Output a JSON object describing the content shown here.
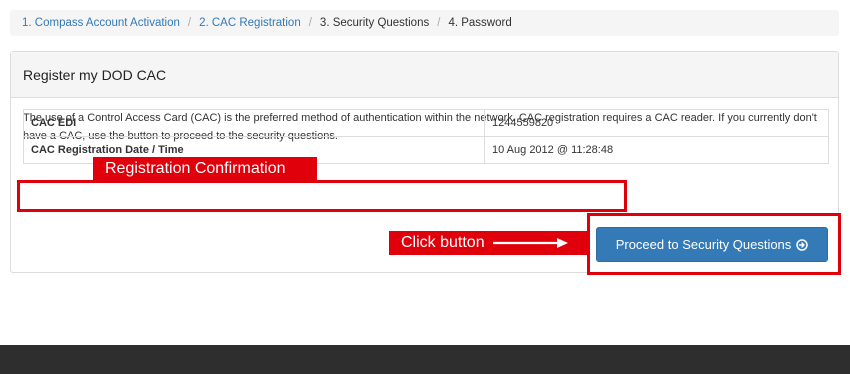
{
  "breadcrumb": {
    "items": [
      {
        "label": "1. Compass Account Activation"
      },
      {
        "label": "2. CAC Registration"
      },
      {
        "label": "3. Security Questions"
      },
      {
        "label": "4. Password"
      }
    ],
    "separator": "/"
  },
  "panel": {
    "title": "Register my DOD CAC",
    "intro": "The use of a Control Access Card (CAC) is the preferred method of authentication within the network. CAC registration requires a CAC reader. If you currently don't have a CAC, use the button to proceed to the security questions.",
    "rows": [
      {
        "label": "CAC EDI",
        "value": "1244559820"
      },
      {
        "label": "CAC Registration Date / Time",
        "value": "10 Aug 2012 @ 11:28:48"
      }
    ],
    "proceed_button": "Proceed to Security Questions"
  },
  "annotations": {
    "registration_label": "Registration Confirmation",
    "click_label": "Click button",
    "color": "#e0000b"
  },
  "colors": {
    "primary": "#337ab7",
    "link": "#337ab7",
    "footer": "#2e2e2e"
  },
  "icons": {
    "proceed": "arrow-circle-right-icon",
    "annotation_arrow": "arrow-right-icon"
  }
}
